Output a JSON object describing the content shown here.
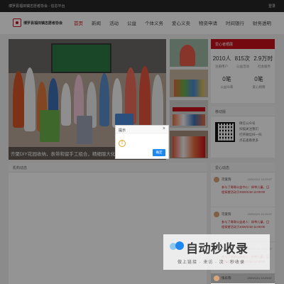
{
  "topbar": {
    "site": "博罗县福田镇志愿者协会 - 信息平台",
    "login": "登录"
  },
  "header": {
    "org": "博罗县福田镇志愿者协会",
    "nav": [
      "首页",
      "新闻",
      "活动",
      "公益",
      "个体义务",
      "爱心义卖",
      "物资申请",
      "时间银行",
      "财务透明"
    ]
  },
  "banner": {
    "caption": "齐聚DIY花园收纳，表带和留手工组合，精细服大化..."
  },
  "stats": {
    "title": "爱心者晒展",
    "row1": [
      {
        "num": "2010人",
        "label": "注册用户"
      },
      {
        "num": "815次",
        "label": "公益活动"
      },
      {
        "num": "2.9万时",
        "label": "社会服务"
      }
    ],
    "row2": [
      {
        "num": "0笔",
        "label": "公益众筹"
      },
      {
        "num": "0笔",
        "label": "爱心捐赠"
      }
    ]
  },
  "mobile": {
    "title": "移动版",
    "lines": [
      "微信公众号",
      "扫描关注我们",
      "打开微信扫一扫",
      "点击查看更多"
    ]
  },
  "news": {
    "title": "机构动态"
  },
  "volunteer": {
    "title": "爱心动态",
    "items": [
      {
        "who": "可爱狗",
        "when": "2020/12/1 10:29:57",
        "what": "参与了哥哥公益中心：探爷儿童，日程探望活动于2020/1/18 11:00:00"
      },
      {
        "who": "可爱狗",
        "when": "2020/12/1 10:29:57",
        "what": "参与了哥哥公益老人：探爷儿童，日程探望活动于2020/1/18 11:00:00"
      },
      {
        "who": "可爱狗",
        "when": "2020/12/1 10:29:57",
        "what": "参与了哥哥公益老人：探爷儿童，日程探望活动于2020/1/18 11:00:00"
      }
    ],
    "last_who": "快乐狗",
    "last_when": "2020/12/1 10:29:57"
  },
  "dialog": {
    "title": "提示",
    "icon": "!",
    "ok": "确定",
    "close": "×"
  },
  "watermark": {
    "title": "自动秒收录",
    "subtitle": "做上链接 · 来访 · 次 · 秒收录"
  }
}
